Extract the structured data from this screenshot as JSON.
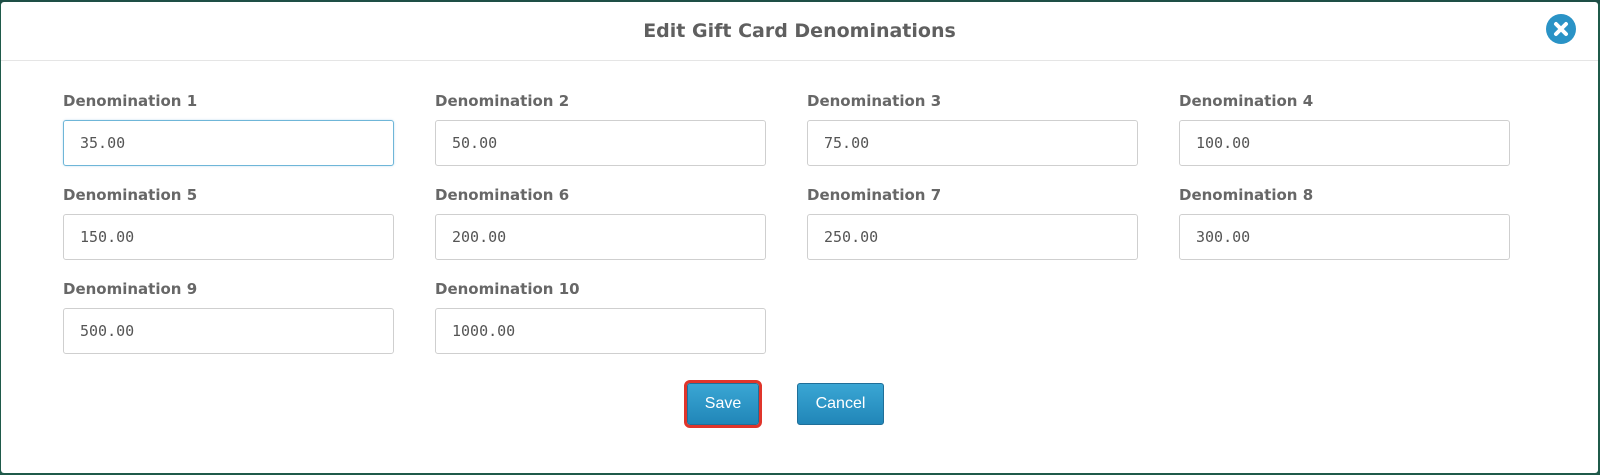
{
  "dialog": {
    "title": "Edit Gift Card Denominations"
  },
  "fields": [
    {
      "label": "Denomination 1",
      "value": "35.00"
    },
    {
      "label": "Denomination 2",
      "value": "50.00"
    },
    {
      "label": "Denomination 3",
      "value": "75.00"
    },
    {
      "label": "Denomination 4",
      "value": "100.00"
    },
    {
      "label": "Denomination 5",
      "value": "150.00"
    },
    {
      "label": "Denomination 6",
      "value": "200.00"
    },
    {
      "label": "Denomination 7",
      "value": "250.00"
    },
    {
      "label": "Denomination 8",
      "value": "300.00"
    },
    {
      "label": "Denomination 9",
      "value": "500.00"
    },
    {
      "label": "Denomination 10",
      "value": "1000.00"
    }
  ],
  "actions": {
    "save_label": "Save",
    "cancel_label": "Cancel"
  },
  "icons": {
    "close": "close-icon"
  },
  "colors": {
    "accent": "#2a93c6",
    "highlight": "#e0352b",
    "backdrop": "#1f5a4a"
  }
}
